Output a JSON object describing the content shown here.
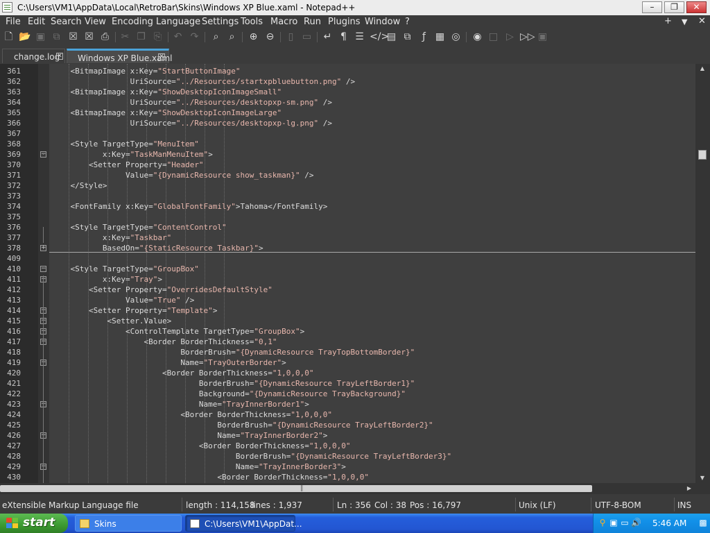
{
  "window": {
    "title": "C:\\Users\\VM1\\AppData\\Local\\RetroBar\\Skins\\Windows XP Blue.xaml - Notepad++",
    "minimize": "–",
    "maximize": "❐",
    "close": "✕"
  },
  "menu": {
    "items": [
      "File",
      "Edit",
      "Search",
      "View",
      "Encoding",
      "Language",
      "Settings",
      "Tools",
      "Macro",
      "Run",
      "Plugins",
      "Window",
      "?"
    ],
    "right": [
      "+",
      "▼",
      "✕"
    ]
  },
  "toolbar": {
    "icons": [
      "new-file-icon",
      "open-file-icon",
      "save-icon",
      "save-all-icon",
      "close-icon",
      "close-all-icon",
      "print-icon",
      "cut-icon",
      "copy-icon",
      "paste-icon",
      "undo-icon",
      "redo-icon",
      "find-icon",
      "replace-icon",
      "zoom-in-icon",
      "zoom-out-icon",
      "sync-v-icon",
      "sync-h-icon",
      "word-wrap-icon",
      "all-chars-icon",
      "indent-guide-icon",
      "xml-tag-icon",
      "doc-map-icon",
      "clone-icon",
      "function-list-icon",
      "folder-workspace-icon",
      "monitoring-icon",
      "record-macro-icon",
      "stop-record-icon",
      "play-macro-icon",
      "run-macro-multiple-icon",
      "save-macro-icon"
    ]
  },
  "tabs": [
    {
      "label": "change.log",
      "active": false
    },
    {
      "label": "Windows XP Blue.xaml",
      "active": true
    }
  ],
  "editor": {
    "lines": [
      {
        "n": "361",
        "text": "    <BitmapImage x:Key=\"StartButtonImage\""
      },
      {
        "n": "362",
        "text": "                 UriSource=\"../Resources/startxpbluebutton.png\" />"
      },
      {
        "n": "363",
        "text": "    <BitmapImage x:Key=\"ShowDesktopIconImageSmall\""
      },
      {
        "n": "364",
        "text": "                 UriSource=\"../Resources/desktopxp-sm.png\" />"
      },
      {
        "n": "365",
        "text": "    <BitmapImage x:Key=\"ShowDesktopIconImageLarge\""
      },
      {
        "n": "366",
        "text": "                 UriSource=\"../Resources/desktopxp-lg.png\" />"
      },
      {
        "n": "367",
        "text": ""
      },
      {
        "n": "368",
        "text": "    <Style TargetType=\"MenuItem\""
      },
      {
        "n": "369",
        "text": "           x:Key=\"TaskManMenuItem\">"
      },
      {
        "n": "370",
        "text": "        <Setter Property=\"Header\""
      },
      {
        "n": "371",
        "text": "                Value=\"{DynamicResource show_taskman}\" />"
      },
      {
        "n": "372",
        "text": "    </Style>"
      },
      {
        "n": "373",
        "text": ""
      },
      {
        "n": "374",
        "text": "    <FontFamily x:Key=\"GlobalFontFamily\">Tahoma</FontFamily>"
      },
      {
        "n": "375",
        "text": ""
      },
      {
        "n": "376",
        "text": "    <Style TargetType=\"ContentControl\""
      },
      {
        "n": "377",
        "text": "           x:Key=\"Taskbar\""
      },
      {
        "n": "378",
        "text": "           BasedOn=\"{StaticResource Taskbar}\">"
      },
      {
        "n": "409",
        "text": ""
      },
      {
        "n": "410",
        "text": "    <Style TargetType=\"GroupBox\""
      },
      {
        "n": "411",
        "text": "           x:Key=\"Tray\">"
      },
      {
        "n": "412",
        "text": "        <Setter Property=\"OverridesDefaultStyle\""
      },
      {
        "n": "413",
        "text": "                Value=\"True\" />"
      },
      {
        "n": "414",
        "text": "        <Setter Property=\"Template\">"
      },
      {
        "n": "415",
        "text": "            <Setter.Value>"
      },
      {
        "n": "416",
        "text": "                <ControlTemplate TargetType=\"GroupBox\">"
      },
      {
        "n": "417",
        "text": "                    <Border BorderThickness=\"0,1\""
      },
      {
        "n": "418",
        "text": "                            BorderBrush=\"{DynamicResource TrayTopBottomBorder}\""
      },
      {
        "n": "419",
        "text": "                            Name=\"TrayOuterBorder\">"
      },
      {
        "n": "420",
        "text": "                        <Border BorderThickness=\"1,0,0,0\""
      },
      {
        "n": "421",
        "text": "                                BorderBrush=\"{DynamicResource TrayLeftBorder1}\""
      },
      {
        "n": "422",
        "text": "                                Background=\"{DynamicResource TrayBackground}\""
      },
      {
        "n": "423",
        "text": "                                Name=\"TrayInnerBorder1\">"
      },
      {
        "n": "424",
        "text": "                            <Border BorderThickness=\"1,0,0,0\""
      },
      {
        "n": "425",
        "text": "                                    BorderBrush=\"{DynamicResource TrayLeftBorder2}\""
      },
      {
        "n": "426",
        "text": "                                    Name=\"TrayInnerBorder2\">"
      },
      {
        "n": "427",
        "text": "                                <Border BorderThickness=\"1,0,0,0\""
      },
      {
        "n": "428",
        "text": "                                        BorderBrush=\"{DynamicResource TrayLeftBorder3}\""
      },
      {
        "n": "429",
        "text": "                                        Name=\"TrayInnerBorder3\">"
      },
      {
        "n": "430",
        "text": "                                    <Border BorderThickness=\"1,0,0,0\""
      }
    ]
  },
  "status": {
    "filetype": "eXtensible Markup Language file",
    "length": "length : 114,158",
    "lines": "lines : 1,937",
    "ln": "Ln : 356",
    "col": "Col : 38",
    "pos": "Pos : 16,797",
    "eol": "Unix (LF)",
    "encoding": "UTF-8-BOM",
    "mode": "INS"
  },
  "taskbar": {
    "start_label": "start",
    "tasks": [
      {
        "label": "Skins"
      },
      {
        "label": "C:\\Users\\VM1\\AppDat..."
      }
    ],
    "clock": "5:46 AM"
  },
  "colors": {
    "tag": "#dcdcdc",
    "attr_value": "#e8b7ad",
    "accent": "#4ba3d9"
  }
}
